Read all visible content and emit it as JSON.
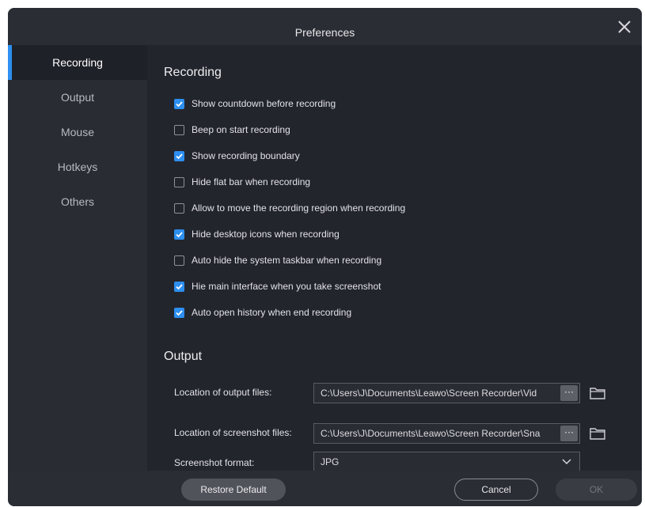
{
  "window": {
    "title": "Preferences"
  },
  "sidebar": {
    "items": [
      {
        "label": "Recording",
        "active": true
      },
      {
        "label": "Output"
      },
      {
        "label": "Mouse"
      },
      {
        "label": "Hotkeys"
      },
      {
        "label": "Others"
      }
    ]
  },
  "recording": {
    "title": "Recording",
    "options": [
      {
        "label": "Show countdown before recording",
        "checked": true
      },
      {
        "label": "Beep on start recording",
        "checked": false
      },
      {
        "label": "Show recording boundary",
        "checked": true
      },
      {
        "label": "Hide flat bar when recording",
        "checked": false
      },
      {
        "label": "Allow to move the recording region when recording",
        "checked": false
      },
      {
        "label": "Hide desktop icons when recording",
        "checked": true
      },
      {
        "label": "Auto hide the system taskbar when recording",
        "checked": false
      },
      {
        "label": "Hie main interface when you take screenshot",
        "checked": true
      },
      {
        "label": "Auto open history when end recording",
        "checked": true
      }
    ]
  },
  "output": {
    "title": "Output",
    "output_files_label": "Location of output files:",
    "output_files_value": "C:\\Users\\J\\Documents\\Leawo\\Screen Recorder\\Vid",
    "screenshot_files_label": "Location of screenshot files:",
    "screenshot_files_value": "C:\\Users\\J\\Documents\\Leawo\\Screen Recorder\\Sna",
    "browse_label": "···",
    "format_label": "Screenshot format:",
    "format_value": "JPG"
  },
  "footer": {
    "restore_label": "Restore Default",
    "cancel_label": "Cancel",
    "ok_label": "OK"
  },
  "colors": {
    "accent": "#2d8ff0",
    "background": "#23252d",
    "sidebar": "#2a2c34"
  }
}
